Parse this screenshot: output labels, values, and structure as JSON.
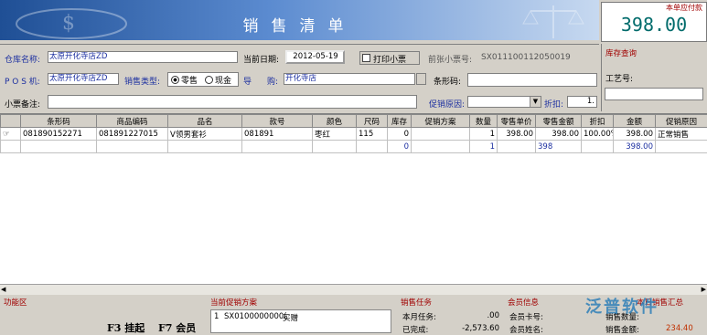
{
  "header": {
    "title": "销售清单",
    "due_label": "本单应付款",
    "due_value": "398.00"
  },
  "form": {
    "warehouse_label": "仓库名称:",
    "warehouse_value": "太原开化寺店ZD",
    "date_label": "当前日期:",
    "date_value": "2012-05-19",
    "print_label": "打印小票",
    "prev_receipt_label": "前张小票号:",
    "prev_receipt_value": "SX011100112050019",
    "pos_label": "P O S 机:",
    "pos_value": "太原开化寺店ZD",
    "sale_type_label": "销售类型:",
    "sale_type_opt1": "零售",
    "sale_type_opt2": "现金",
    "guide_label": "导",
    "buy_label": "购:",
    "buy_value": "开化寺店",
    "barcode_label": "条形码:",
    "barcode_value": "",
    "note_label": "小票备注:",
    "note_value": "",
    "promo_reason_label": "促销原因:",
    "discount_label": "折扣:",
    "discount_value": "1."
  },
  "side": {
    "stock_query_label": "库存查询",
    "craft_label": "工艺号:"
  },
  "table": {
    "columns": [
      "条形码",
      "商品编码",
      "品名",
      "款号",
      "颜色",
      "尺码",
      "库存",
      "促销方案",
      "数量",
      "零售单价",
      "零售金额",
      "折扣",
      "金额",
      "促销原因"
    ],
    "rows": [
      [
        "081890152271",
        "081891227015",
        "V领男套衫",
        "081891",
        "枣红",
        "115",
        "0",
        "",
        "1",
        "398.00",
        "398.00",
        "100.00%",
        "398.00",
        "正常销售"
      ]
    ],
    "totals": {
      "stock": "0",
      "qty": "1",
      "amount_retail": "398",
      "amount": "398.00"
    }
  },
  "bottom": {
    "func_area": "功能区",
    "hang_btn": "F3 挂起",
    "member_btn": "F7 会员",
    "promo_title": "当前促销方案",
    "promo_index": "1",
    "promo_code": "SX0100000000(",
    "promo_name": "买赠",
    "task_title": "销售任务",
    "task_month_label": "本月任务:",
    "task_month_value": ".00",
    "task_done_label": "已完成:",
    "task_done_value": "-2,573.60",
    "member_title": "会员信息",
    "member_card_label": "会员卡号:",
    "member_name_label": "会员姓名:",
    "shift_title": "本日销售汇总",
    "shift_qty_label": "销售数量:",
    "shift_amount_label": "销售金额:",
    "shift_amount_value": "234.40",
    "watermark": "泛普软件"
  }
}
